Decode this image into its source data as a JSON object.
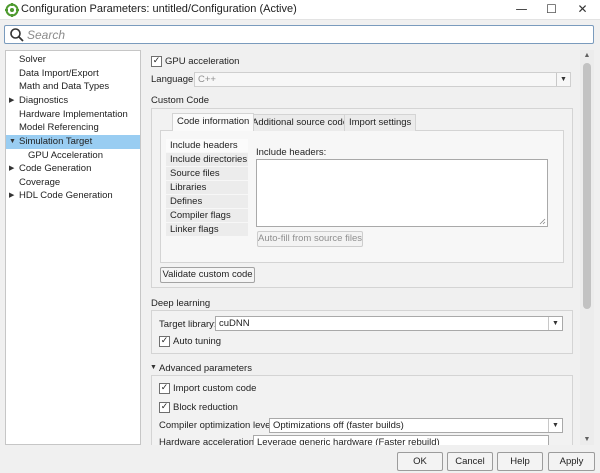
{
  "window": {
    "title": "Configuration Parameters: untitled/Configuration (Active)",
    "minimize": "—",
    "maximize": "☐",
    "close": "✕"
  },
  "search": {
    "placeholder": "Search",
    "value": ""
  },
  "tree": {
    "items": [
      {
        "label": "Solver",
        "expander": ""
      },
      {
        "label": "Data Import/Export",
        "expander": ""
      },
      {
        "label": "Math and Data Types",
        "expander": ""
      },
      {
        "label": "Diagnostics",
        "expander": "▶"
      },
      {
        "label": "Hardware Implementation",
        "expander": ""
      },
      {
        "label": "Model Referencing",
        "expander": ""
      },
      {
        "label": "Simulation Target",
        "expander": "▼",
        "selected": true
      },
      {
        "label": "GPU Acceleration",
        "expander": ""
      },
      {
        "label": "Code Generation",
        "expander": "▶"
      },
      {
        "label": "Coverage",
        "expander": ""
      },
      {
        "label": "HDL Code Generation",
        "expander": "▶"
      }
    ]
  },
  "main": {
    "gpu_acceleration": {
      "label": "GPU acceleration",
      "checked": true
    },
    "language": {
      "label": "Language:",
      "value": "C++",
      "enabled": false
    },
    "custom_code": {
      "section_title": "Custom Code",
      "tabs": [
        {
          "label": "Code information",
          "active": true
        },
        {
          "label": "Additional source code",
          "active": false
        },
        {
          "label": "Import settings",
          "active": false
        }
      ],
      "categories": [
        {
          "label": "Include headers",
          "selected": true
        },
        {
          "label": "Include directories",
          "selected": false
        },
        {
          "label": "Source files",
          "selected": false
        },
        {
          "label": "Libraries",
          "selected": false
        },
        {
          "label": "Defines",
          "selected": false
        },
        {
          "label": "Compiler flags",
          "selected": false
        },
        {
          "label": "Linker flags",
          "selected": false
        }
      ],
      "editor_label": "Include headers:",
      "editor_value": "",
      "autofill_button": "Auto-fill from source files",
      "validate_button": "Validate custom code"
    },
    "deep_learning": {
      "section_title": "Deep learning",
      "target_library_label": "Target library:",
      "target_library_value": "cuDNN",
      "auto_tuning": {
        "label": "Auto tuning",
        "checked": true
      }
    },
    "advanced": {
      "section_title": "Advanced parameters",
      "expander": "▼",
      "import_custom_code": {
        "label": "Import custom code",
        "checked": true
      },
      "block_reduction": {
        "label": "Block reduction",
        "checked": true
      },
      "compiler_opt_label": "Compiler optimization level:",
      "compiler_opt_value": "Optimizations off (faster builds)",
      "hardware_accel_label": "Hardware acceleration:",
      "hardware_accel_value": "Leverage generic hardware (Faster rebuild)"
    }
  },
  "buttons": {
    "ok": "OK",
    "cancel": "Cancel",
    "help": "Help",
    "apply": "Apply"
  },
  "colors": {
    "selection": "#99cdf2",
    "search_border": "#7a9bbd",
    "app_icon": "#4e9a2f"
  }
}
